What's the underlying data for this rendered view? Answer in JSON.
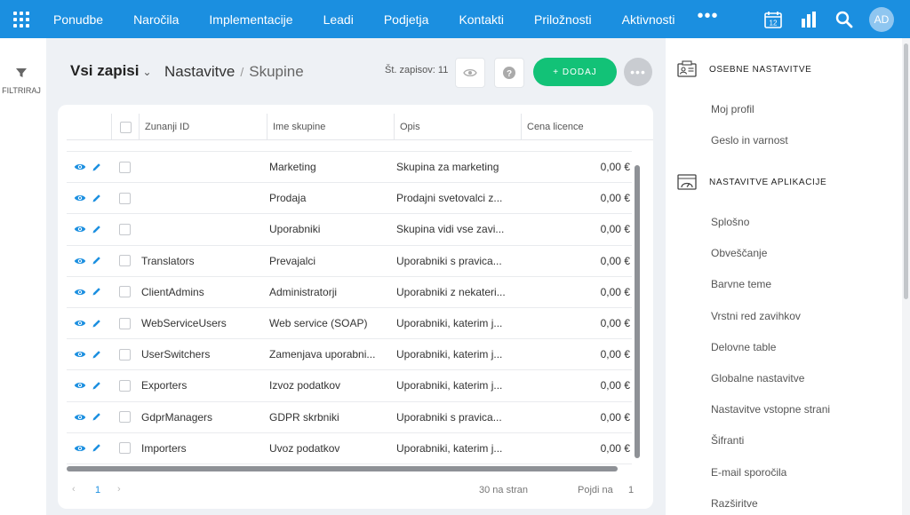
{
  "nav": {
    "items": [
      "Ponudbe",
      "Naročila",
      "Implementacije",
      "Leadi",
      "Podjetja",
      "Kontakti",
      "Priložnosti",
      "Aktivnosti"
    ],
    "more": "•••",
    "calendar_day": "12",
    "avatar": "AD"
  },
  "left_rail": {
    "filter_label": "FILTRIRAJ"
  },
  "header": {
    "all_records": "Vsi zapisi",
    "breadcrumb_parent": "Nastavitve",
    "breadcrumb_separator": "/",
    "breadcrumb_current": "Skupine",
    "record_count": "Št. zapisov: 11",
    "add_label": "+ DODAJ"
  },
  "table": {
    "columns": [
      "Zunanji ID",
      "Ime skupine",
      "Opis",
      "Cena licence"
    ],
    "rows": [
      {
        "ext": "",
        "name": "Marketing",
        "desc": "Skupina za marketing",
        "price": "0,00 €"
      },
      {
        "ext": "",
        "name": "Prodaja",
        "desc": "Prodajni svetovalci z...",
        "price": "0,00 €"
      },
      {
        "ext": "",
        "name": "Uporabniki",
        "desc": "Skupina vidi vse zavi...",
        "price": "0,00 €"
      },
      {
        "ext": "Translators",
        "name": "Prevajalci",
        "desc": "Uporabniki s pravica...",
        "price": "0,00 €"
      },
      {
        "ext": "ClientAdmins",
        "name": "Administratorji",
        "desc": "Uporabniki z nekateri...",
        "price": "0,00 €"
      },
      {
        "ext": "WebServiceUsers",
        "name": "Web service (SOAP)",
        "desc": "Uporabniki, katerim j...",
        "price": "0,00 €"
      },
      {
        "ext": "UserSwitchers",
        "name": "Zamenjava uporabni...",
        "desc": "Uporabniki, katerim j...",
        "price": "0,00 €"
      },
      {
        "ext": "Exporters",
        "name": "Izvoz podatkov",
        "desc": "Uporabniki, katerim j...",
        "price": "0,00 €"
      },
      {
        "ext": "GdprManagers",
        "name": "GDPR skrbniki",
        "desc": "Uporabniki s pravica...",
        "price": "0,00 €"
      },
      {
        "ext": "Importers",
        "name": "Uvoz podatkov",
        "desc": "Uporabniki, katerim j...",
        "price": "0,00 €"
      }
    ]
  },
  "pager": {
    "prev": "‹",
    "page": "1",
    "next": "›",
    "per_page": "30 na stran",
    "jump_label": "Pojdi na",
    "jump_value": "1"
  },
  "right_panel": {
    "personal": {
      "title": "OSEBNE NASTAVITVE",
      "items": [
        "Moj profil",
        "Geslo in varnost"
      ]
    },
    "app": {
      "title": "NASTAVITVE APLIKACIJE",
      "items": [
        "Splošno",
        "Obveščanje",
        "Barvne teme",
        "Vrstni red zavihkov",
        "Delovne table",
        "Globalne nastavitve",
        "Nastavitve vstopne strani",
        "Šifranti",
        "E-mail sporočila",
        "Razširitve"
      ]
    }
  },
  "colors": {
    "topbar": "#1b8fe0",
    "accent_green": "#12c277",
    "link_blue": "#1b8fe0"
  }
}
